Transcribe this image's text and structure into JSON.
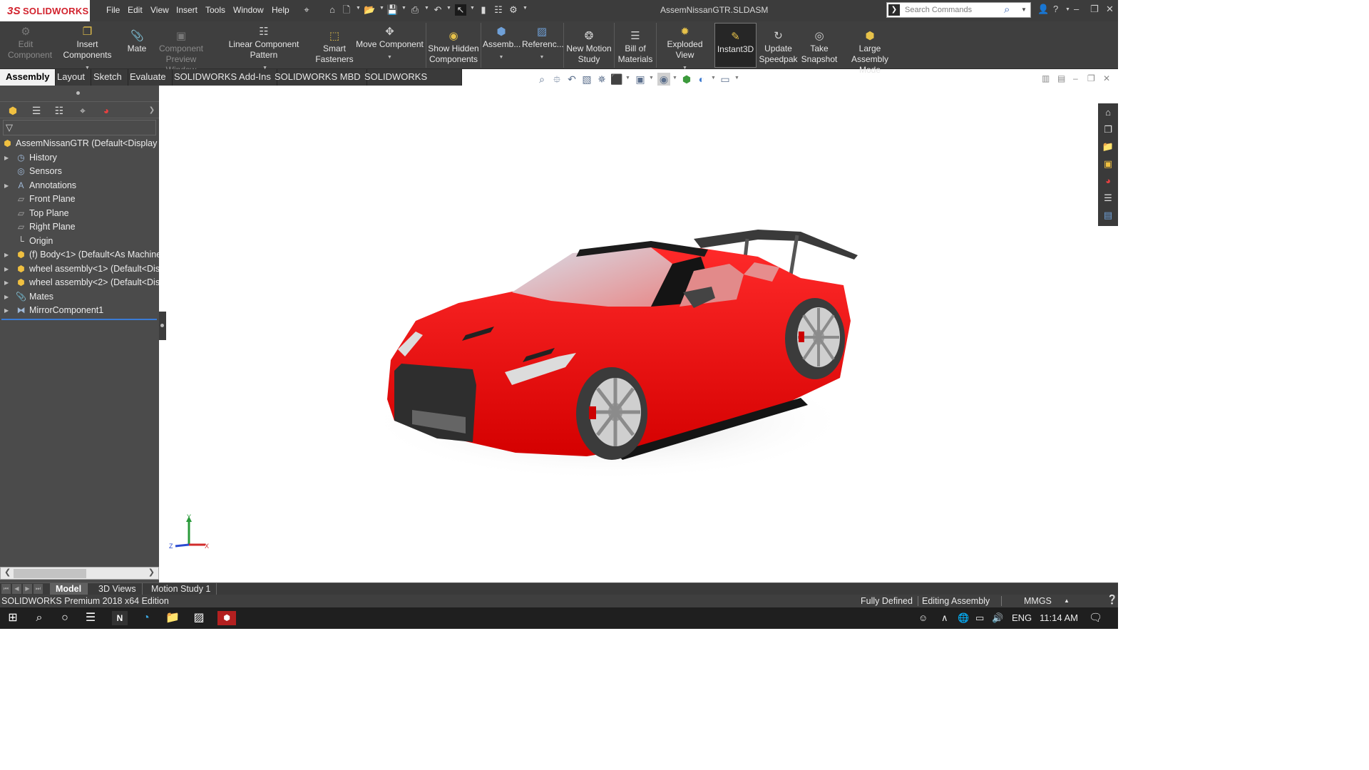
{
  "app": {
    "brand": "SOLIDWORKS",
    "document_title": "AssemNissanGTR.SLDASM",
    "brand_color": "#d2222d"
  },
  "menu": [
    "File",
    "Edit",
    "View",
    "Insert",
    "Tools",
    "Window",
    "Help"
  ],
  "search": {
    "placeholder": "Search Commands"
  },
  "commands": {
    "edit_component": "Edit Component",
    "insert_components": "Insert Components",
    "mate": "Mate",
    "component_preview": "Component Preview Window",
    "linear_pattern": "Linear Component Pattern",
    "smart_fasteners": "Smart Fasteners",
    "move_component": "Move Component",
    "show_hidden": "Show Hidden Components",
    "assembly": "Assemb...",
    "reference": "Referenc...",
    "new_motion_study": "New Motion Study",
    "bill_of_materials": "Bill of Materials",
    "exploded_view": "Exploded View",
    "instant3d": "Instant3D",
    "update_speedpak": "Update Speedpak",
    "take_snapshot": "Take Snapshot",
    "large_assembly": "Large Assembly Mode"
  },
  "tabs": [
    "Assembly",
    "Layout",
    "Sketch",
    "Evaluate",
    "SOLIDWORKS Add-Ins",
    "SOLIDWORKS MBD",
    "SOLIDWORKS Visualize"
  ],
  "active_tab": "Assembly",
  "tree": {
    "root": "AssemNissanGTR  (Default<Display S",
    "items": [
      "History",
      "Sensors",
      "Annotations",
      "Front Plane",
      "Top Plane",
      "Right Plane",
      "Origin",
      "(f) Body<1> (Default<As Machine",
      "wheel assembly<1> (Default<Dis",
      "wheel assembly<2> (Default<Dis",
      "Mates",
      "MirrorComponent1"
    ]
  },
  "triad": {
    "y": "Y",
    "z": "Z",
    "x": "X"
  },
  "bottom_tabs": [
    "Model",
    "3D Views",
    "Motion Study 1"
  ],
  "status": {
    "edition": "SOLIDWORKS Premium 2018 x64 Edition",
    "state": "Fully Defined",
    "mode": "Editing Assembly",
    "units": "MMGS"
  },
  "taskbar": {
    "language": "ENG",
    "time": "11:14 AM"
  }
}
